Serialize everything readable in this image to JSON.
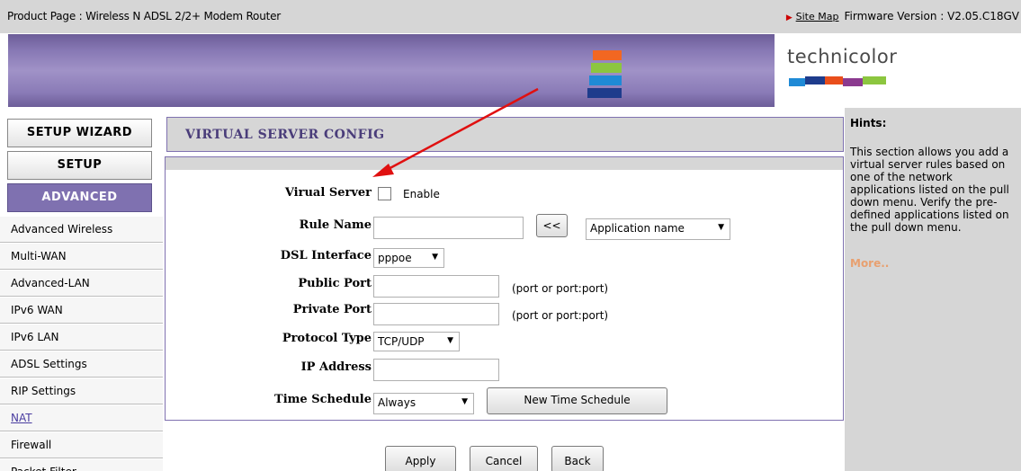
{
  "topbar": {
    "product_page": "Product Page : Wireless N ADSL 2/2+ Modem Router",
    "site_map": "Site Map",
    "firmware": "Firmware Version : V2.05.C18GV"
  },
  "banner": {
    "brand": "technicolor",
    "stripe_colors": [
      "#f26722",
      "#8cc63f",
      "#1f8ad6",
      "#1e3c8c"
    ],
    "logo_bar_colors": [
      "#1f8ad6",
      "#1e3c8c",
      "#e94e1b",
      "#8b3a8f",
      "#8cc63f"
    ]
  },
  "nav": {
    "setup_wizard": "SETUP WIZARD",
    "setup": "SETUP",
    "advanced": "ADVANCED",
    "items": [
      "Advanced Wireless",
      "Multi-WAN",
      "Advanced-LAN",
      "IPv6 WAN",
      "IPv6 LAN",
      "ADSL Settings",
      "RIP Settings",
      "NAT",
      "Firewall",
      "Packet Filter"
    ]
  },
  "main": {
    "title": "VIRTUAL SERVER CONFIG",
    "form": {
      "virtual_server_label": "Virual Server",
      "enable_label": "Enable",
      "rule_name_label": "Rule Name",
      "rule_name_value": "",
      "copy_button": "<<",
      "application_select": "Application name",
      "dsl_interface_label": "DSL Interface",
      "dsl_interface_value": "pppoe",
      "public_port_label": "Public Port",
      "public_port_value": "",
      "public_port_note": "(port or port:port)",
      "private_port_label": "Private Port",
      "private_port_value": "",
      "private_port_note": "(port or port:port)",
      "protocol_label": "Protocol Type",
      "protocol_value": "TCP/UDP",
      "ip_label": "IP Address",
      "ip_value": "",
      "schedule_label": "Time Schedule",
      "schedule_value": "Always",
      "new_schedule_button": "New Time Schedule"
    },
    "buttons": {
      "apply": "Apply",
      "cancel": "Cancel",
      "back": "Back"
    }
  },
  "hints": {
    "title": "Hints:",
    "body": "This section allows you add a virtual server rules based on one of the network applications listed on the pull down menu. Verify the pre-defined applications listed on the pull down menu.",
    "more": "More.."
  },
  "colors": {
    "accent": "#7f71b0",
    "annotation": "#e01010"
  }
}
